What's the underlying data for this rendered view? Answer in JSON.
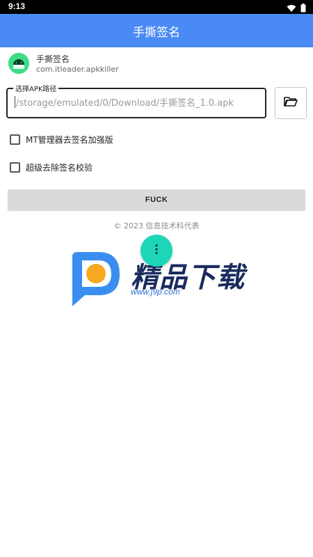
{
  "status_bar": {
    "time": "9:13",
    "icons": [
      "wifi-icon",
      "battery-icon"
    ]
  },
  "app_bar": {
    "title": "手撕签名"
  },
  "app_info": {
    "name": "手撕签名",
    "package": "com.itleader.apkkiller",
    "icon": "android-icon"
  },
  "path_field": {
    "label": "选择APK路径",
    "value": "/storage/emulated/0/Download/手撕签名_1.0.apk"
  },
  "folder_button": {
    "icon": "folder-open-icon"
  },
  "options": [
    {
      "label": "MT管理器去签名加强版",
      "checked": false
    },
    {
      "label": "超级去除签名校验",
      "checked": false
    }
  ],
  "action_button": {
    "label": "FUCK"
  },
  "footer": {
    "copyright": "© 2023 信息技术科代表"
  },
  "fab": {
    "icon": "more-vertical-icon"
  },
  "watermark": {
    "text": "精品下载",
    "url": "www.j9p.com"
  },
  "colors": {
    "app_bar": "#4a8af4",
    "fab": "#1dd6b8",
    "button": "#d9dada"
  }
}
